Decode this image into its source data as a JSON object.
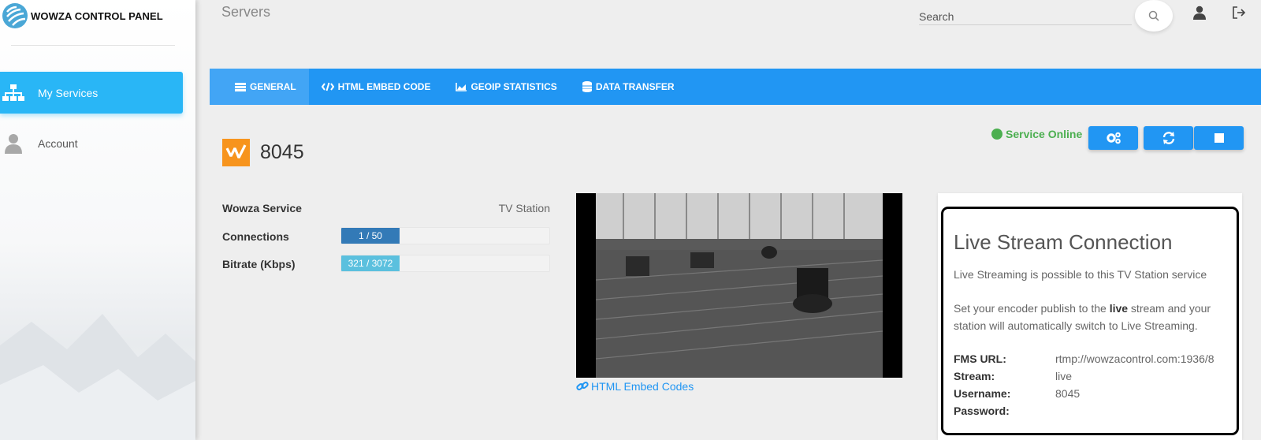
{
  "app": {
    "brand": "WOWZA CONTROL PANEL"
  },
  "sidebar": {
    "items": [
      {
        "label": "My Services",
        "icon": "sitemap-icon",
        "active": true
      },
      {
        "label": "Account",
        "icon": "user-icon",
        "active": false
      }
    ]
  },
  "header": {
    "title": "Servers",
    "search": {
      "placeholder": "Search",
      "value": ""
    }
  },
  "tabs": [
    {
      "label": "GENERAL",
      "icon": "list-icon",
      "active": true
    },
    {
      "label": "HTML EMBED CODE",
      "icon": "code-icon",
      "active": false
    },
    {
      "label": "GEOIP STATISTICS",
      "icon": "area-chart-icon",
      "active": false
    },
    {
      "label": "DATA TRANSFER",
      "icon": "database-icon",
      "active": false
    }
  ],
  "service": {
    "name": "8045",
    "status": "Service Online",
    "status_color": "#4caf50"
  },
  "stats": {
    "wowza_service": {
      "label": "Wowza Service",
      "value": "TV Station"
    },
    "connections": {
      "label": "Connections",
      "text": "1 / 50",
      "fraction": 0.28,
      "color": "#337ab7"
    },
    "bitrate": {
      "label": "Bitrate (Kbps)",
      "text": "321 / 3072",
      "fraction": 0.28,
      "color": "#5bc0de"
    }
  },
  "embed_link": "HTML Embed Codes",
  "live": {
    "title": "Live Stream Connection",
    "line1": "Live Streaming is possible to this TV Station service",
    "line2_pre": "Set your encoder publish to the ",
    "line2_bold": "live",
    "line2_post": " stream and your station will automatically switch to Live Streaming.",
    "fields": [
      {
        "label": "FMS URL:",
        "value": "rtmp://wowzacontrol.com:1936/8"
      },
      {
        "label": "Stream:",
        "value": "live"
      },
      {
        "label": "Username:",
        "value": "8045"
      },
      {
        "label": "Password:",
        "value": ""
      }
    ]
  },
  "colors": {
    "accent": "#2196f3",
    "sidebar_active": "#29b6f6",
    "tab_active": "#42a5f5",
    "link": "#2196f3"
  }
}
